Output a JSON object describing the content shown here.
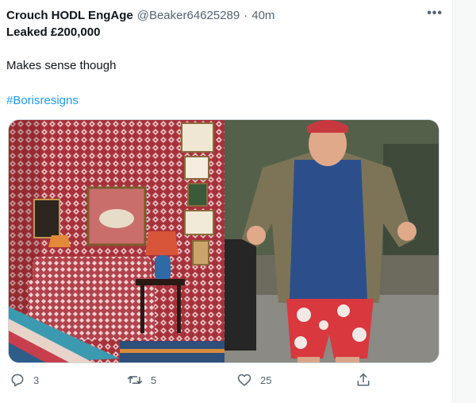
{
  "tweet": {
    "display_name": "Crouch HODL EngAge",
    "handle": "@Beaker64625289",
    "separator": "·",
    "time": "40m",
    "more_icon": "more-horizontal-icon",
    "lines": [
      "Leaked £200,000",
      "Makes sense though"
    ],
    "hashtag": "#Borisresigns"
  },
  "actions": {
    "reply_count": "3",
    "retweet_count": "5",
    "like_count": "25"
  },
  "colors": {
    "accent": "#1d9bf0",
    "secondary_text": "#536471"
  }
}
